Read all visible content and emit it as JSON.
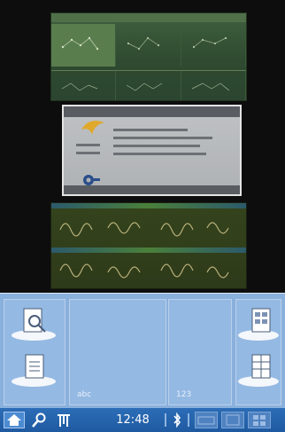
{
  "launcher": {
    "labels": [
      "abc",
      "123"
    ]
  },
  "taskbar": {
    "time": "12:48"
  },
  "colors": {
    "launcher_bg": "#8ab0dc",
    "taskbar_bg": "#2c6db7",
    "screen_bg": "#0d0d0d"
  },
  "icons": [
    "home-icon",
    "search-icon",
    "network-icon",
    "bluetooth-icon",
    "keyboard-icon",
    "window-icon",
    "grid-icon"
  ]
}
